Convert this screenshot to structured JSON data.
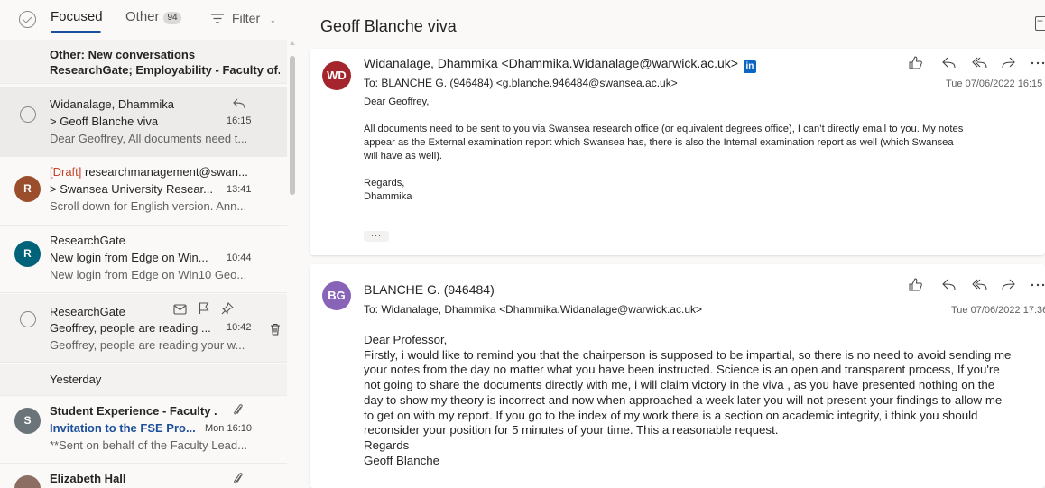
{
  "header": {
    "tab_focused": "Focused",
    "tab_other": "Other",
    "other_count": "94",
    "filter_label": "Filter",
    "sort_icon": "↓"
  },
  "list": {
    "rows": [
      {
        "line1": "Other: New conversations",
        "line2": "ResearchGate; Employability - Faculty of..."
      },
      {
        "line1": "Widanalage, Dhammika",
        "line2": "> Geoff Blanche viva",
        "time": "16:15",
        "line3": "Dear Geoffrey, All documents need t..."
      },
      {
        "avatar": "R",
        "avatar_color": "#9a4e2c",
        "draft": "[Draft]",
        "line1": " researchmanagement@swan...",
        "line2": "> Swansea University Resear...",
        "time": "13:41",
        "line3": "Scroll down for English version. Ann..."
      },
      {
        "avatar": "R",
        "avatar_color": "#00637a",
        "line1": "ResearchGate",
        "line2": "New login from Edge on Win...",
        "time": "10:44",
        "line3": "New login from Edge on Win10 Geo..."
      },
      {
        "line1": "ResearchGate",
        "line2": "Geoffrey, people are reading ...",
        "time": "10:42",
        "line3": "Geoffrey, people are reading your w..."
      },
      {
        "day": "Yesterday"
      },
      {
        "avatar": "S",
        "avatar_color": "#6b7479",
        "line1": "Student Experience - Faculty ...",
        "line2": "Invitation to the FSE Pro...",
        "time": "Mon 16:10",
        "line3": "**Sent on behalf of the Faculty Lead..."
      },
      {
        "line1": "Elizabeth Hall"
      }
    ]
  },
  "pane": {
    "subject": "Geoff Blanche viva",
    "messages": [
      {
        "avatar": "WD",
        "avatar_color": "#a4262c",
        "sender": "Widanalage, Dhammika <Dhammika.Widanalage@warwick.ac.uk>",
        "linkedin": "in",
        "to": "To:  BLANCHE G. (946484) <g.blanche.946484@swansea.ac.uk>",
        "date": "Tue 07/06/2022 16:15",
        "body": [
          "Dear Geoffrey,",
          "",
          "All documents need to be sent to you via Swansea research office (or equivalent degrees office), I can’t directly email to you. My notes",
          "appear as the External examination report which Swansea has, there is also the Internal examination report as well (which Swansea",
          "will have as well).",
          "",
          "Regards,",
          "Dhammika"
        ],
        "ellipsis": "..."
      },
      {
        "avatar": "BG",
        "avatar_color": "#8764b8",
        "sender": "BLANCHE G. (946484)",
        "to": "To:  Widanalage, Dhammika <Dhammika.Widanalage@warwick.ac.uk>",
        "date": "Tue 07/06/2022 17:36",
        "body": [
          "Dear Professor,",
          "Firstly, i would like to remind you that the chairperson is supposed to be impartial, so there is no need to avoid sending me",
          "your notes from the day no matter what you have been instructed. Science is an open and transparent process, If you're",
          "not going to share the documents directly with me, i will claim victory in the viva , as you have presented nothing on the",
          "day to show my theory is incorrect and now when approached a week later you will not present your findings to allow me",
          "to get on with my report. If you go to the index of my work there is a section on academic integrity, i think you should",
          "reconsider your position for 5 minutes of your time. This a reasonable request.",
          "Regards",
          "Geoff Blanche"
        ]
      }
    ]
  },
  "icons": {
    "select_all": "checkmark-circle-icon",
    "filter": "filter-lines-icon",
    "reply": "reply-icon",
    "reply_all": "reply-all-icon",
    "forward": "forward-icon",
    "like": "thumbs-up-icon",
    "more": "more-icon",
    "attachment": "paperclip-icon",
    "delete": "trash-icon",
    "flag": "flag-icon",
    "pin": "pin-icon",
    "read": "envelope-icon"
  }
}
